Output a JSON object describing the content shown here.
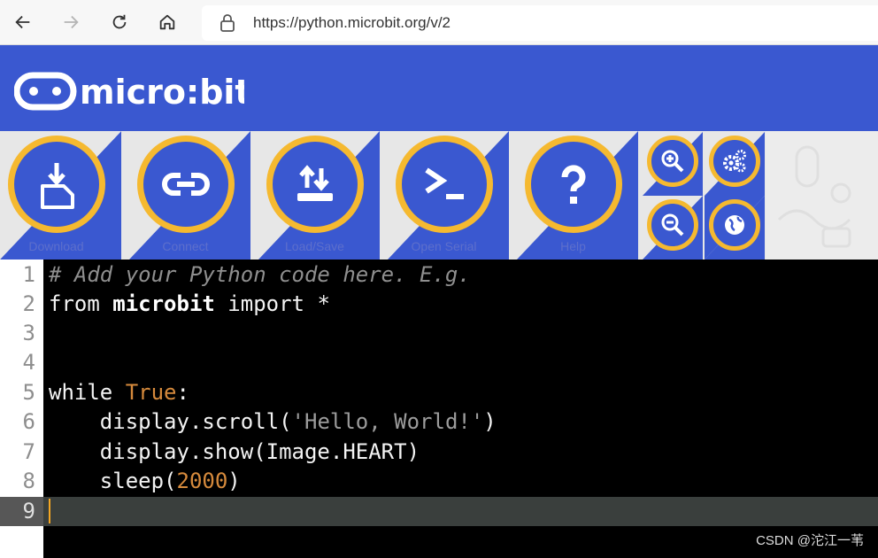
{
  "browser": {
    "url": "https://python.microbit.org/v/2"
  },
  "header": {
    "logo_text": "micro:bit"
  },
  "toolbar": {
    "buttons": [
      {
        "label": "Download"
      },
      {
        "label": "Connect"
      },
      {
        "label": "Load/Save"
      },
      {
        "label": "Open Serial"
      },
      {
        "label": "Help"
      }
    ]
  },
  "editor": {
    "line_numbers": [
      "1",
      "2",
      "3",
      "4",
      "5",
      "6",
      "7",
      "8",
      "9"
    ],
    "lines": [
      {
        "text": "# Add your Python code here. E.g."
      },
      {
        "kw": "from ",
        "mod": "microbit",
        "rest": " import *"
      },
      {
        "text": ""
      },
      {
        "text": ""
      },
      {
        "kw": "while ",
        "val": "True",
        "rest": ":"
      },
      {
        "pre": "    display.scroll(",
        "str": "'Hello, World!'",
        "post": ")"
      },
      {
        "text": "    display.show(Image.HEART)"
      },
      {
        "pre": "    sleep(",
        "num": "2000",
        "post": ")"
      },
      {
        "text": ""
      }
    ],
    "active_line": 9
  },
  "watermark": "CSDN @沱江一苇",
  "colors": {
    "brand_blue": "#3a58d0",
    "button_ring": "#f5b930",
    "editor_bg": "#000000"
  }
}
